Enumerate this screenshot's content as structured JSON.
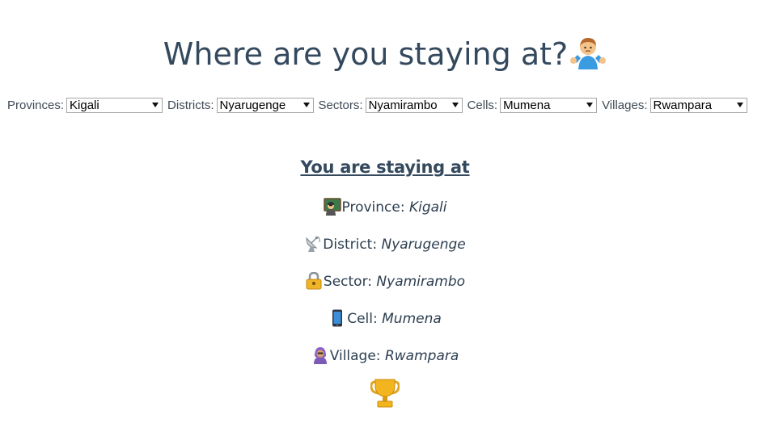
{
  "title": "Where are you staying at?",
  "title_emoji": "person-shrugging-icon",
  "selectors": [
    {
      "label": "Provinces:",
      "value": "Kigali"
    },
    {
      "label": "Districts:",
      "value": "Nyarugenge"
    },
    {
      "label": "Sectors:",
      "value": "Nyamirambo"
    },
    {
      "label": "Cells:",
      "value": "Mumena"
    },
    {
      "label": "Villages:",
      "value": "Rwampara"
    }
  ],
  "summary": {
    "heading": "You are staying at",
    "rows": [
      {
        "label": "Province:",
        "value": "Kigali",
        "icon": "teacher-icon"
      },
      {
        "label": "District:",
        "value": "Nyarugenge",
        "icon": "satellite-dish-icon"
      },
      {
        "label": "Sector:",
        "value": "Nyamirambo",
        "icon": "lock-icon"
      },
      {
        "label": "Cell:",
        "value": "Mumena",
        "icon": "mobile-phone-icon"
      },
      {
        "label": "Village:",
        "value": "Rwampara",
        "icon": "person-with-headscarf-icon"
      }
    ],
    "footer_icon": "trophy-icon"
  }
}
